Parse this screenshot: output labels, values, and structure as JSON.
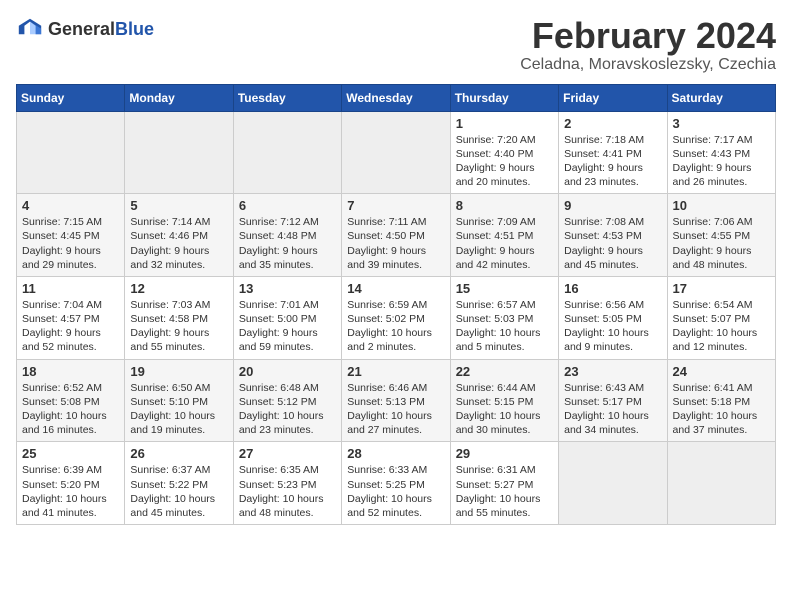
{
  "header": {
    "logo_line1": "General",
    "logo_line2": "Blue",
    "title": "February 2024",
    "subtitle": "Celadna, Moravskoslezsky, Czechia"
  },
  "weekdays": [
    "Sunday",
    "Monday",
    "Tuesday",
    "Wednesday",
    "Thursday",
    "Friday",
    "Saturday"
  ],
  "weeks": [
    [
      {
        "day": "",
        "detail": ""
      },
      {
        "day": "",
        "detail": ""
      },
      {
        "day": "",
        "detail": ""
      },
      {
        "day": "",
        "detail": ""
      },
      {
        "day": "1",
        "detail": "Sunrise: 7:20 AM\nSunset: 4:40 PM\nDaylight: 9 hours\nand 20 minutes."
      },
      {
        "day": "2",
        "detail": "Sunrise: 7:18 AM\nSunset: 4:41 PM\nDaylight: 9 hours\nand 23 minutes."
      },
      {
        "day": "3",
        "detail": "Sunrise: 7:17 AM\nSunset: 4:43 PM\nDaylight: 9 hours\nand 26 minutes."
      }
    ],
    [
      {
        "day": "4",
        "detail": "Sunrise: 7:15 AM\nSunset: 4:45 PM\nDaylight: 9 hours\nand 29 minutes."
      },
      {
        "day": "5",
        "detail": "Sunrise: 7:14 AM\nSunset: 4:46 PM\nDaylight: 9 hours\nand 32 minutes."
      },
      {
        "day": "6",
        "detail": "Sunrise: 7:12 AM\nSunset: 4:48 PM\nDaylight: 9 hours\nand 35 minutes."
      },
      {
        "day": "7",
        "detail": "Sunrise: 7:11 AM\nSunset: 4:50 PM\nDaylight: 9 hours\nand 39 minutes."
      },
      {
        "day": "8",
        "detail": "Sunrise: 7:09 AM\nSunset: 4:51 PM\nDaylight: 9 hours\nand 42 minutes."
      },
      {
        "day": "9",
        "detail": "Sunrise: 7:08 AM\nSunset: 4:53 PM\nDaylight: 9 hours\nand 45 minutes."
      },
      {
        "day": "10",
        "detail": "Sunrise: 7:06 AM\nSunset: 4:55 PM\nDaylight: 9 hours\nand 48 minutes."
      }
    ],
    [
      {
        "day": "11",
        "detail": "Sunrise: 7:04 AM\nSunset: 4:57 PM\nDaylight: 9 hours\nand 52 minutes."
      },
      {
        "day": "12",
        "detail": "Sunrise: 7:03 AM\nSunset: 4:58 PM\nDaylight: 9 hours\nand 55 minutes."
      },
      {
        "day": "13",
        "detail": "Sunrise: 7:01 AM\nSunset: 5:00 PM\nDaylight: 9 hours\nand 59 minutes."
      },
      {
        "day": "14",
        "detail": "Sunrise: 6:59 AM\nSunset: 5:02 PM\nDaylight: 10 hours\nand 2 minutes."
      },
      {
        "day": "15",
        "detail": "Sunrise: 6:57 AM\nSunset: 5:03 PM\nDaylight: 10 hours\nand 5 minutes."
      },
      {
        "day": "16",
        "detail": "Sunrise: 6:56 AM\nSunset: 5:05 PM\nDaylight: 10 hours\nand 9 minutes."
      },
      {
        "day": "17",
        "detail": "Sunrise: 6:54 AM\nSunset: 5:07 PM\nDaylight: 10 hours\nand 12 minutes."
      }
    ],
    [
      {
        "day": "18",
        "detail": "Sunrise: 6:52 AM\nSunset: 5:08 PM\nDaylight: 10 hours\nand 16 minutes."
      },
      {
        "day": "19",
        "detail": "Sunrise: 6:50 AM\nSunset: 5:10 PM\nDaylight: 10 hours\nand 19 minutes."
      },
      {
        "day": "20",
        "detail": "Sunrise: 6:48 AM\nSunset: 5:12 PM\nDaylight: 10 hours\nand 23 minutes."
      },
      {
        "day": "21",
        "detail": "Sunrise: 6:46 AM\nSunset: 5:13 PM\nDaylight: 10 hours\nand 27 minutes."
      },
      {
        "day": "22",
        "detail": "Sunrise: 6:44 AM\nSunset: 5:15 PM\nDaylight: 10 hours\nand 30 minutes."
      },
      {
        "day": "23",
        "detail": "Sunrise: 6:43 AM\nSunset: 5:17 PM\nDaylight: 10 hours\nand 34 minutes."
      },
      {
        "day": "24",
        "detail": "Sunrise: 6:41 AM\nSunset: 5:18 PM\nDaylight: 10 hours\nand 37 minutes."
      }
    ],
    [
      {
        "day": "25",
        "detail": "Sunrise: 6:39 AM\nSunset: 5:20 PM\nDaylight: 10 hours\nand 41 minutes."
      },
      {
        "day": "26",
        "detail": "Sunrise: 6:37 AM\nSunset: 5:22 PM\nDaylight: 10 hours\nand 45 minutes."
      },
      {
        "day": "27",
        "detail": "Sunrise: 6:35 AM\nSunset: 5:23 PM\nDaylight: 10 hours\nand 48 minutes."
      },
      {
        "day": "28",
        "detail": "Sunrise: 6:33 AM\nSunset: 5:25 PM\nDaylight: 10 hours\nand 52 minutes."
      },
      {
        "day": "29",
        "detail": "Sunrise: 6:31 AM\nSunset: 5:27 PM\nDaylight: 10 hours\nand 55 minutes."
      },
      {
        "day": "",
        "detail": ""
      },
      {
        "day": "",
        "detail": ""
      }
    ]
  ]
}
